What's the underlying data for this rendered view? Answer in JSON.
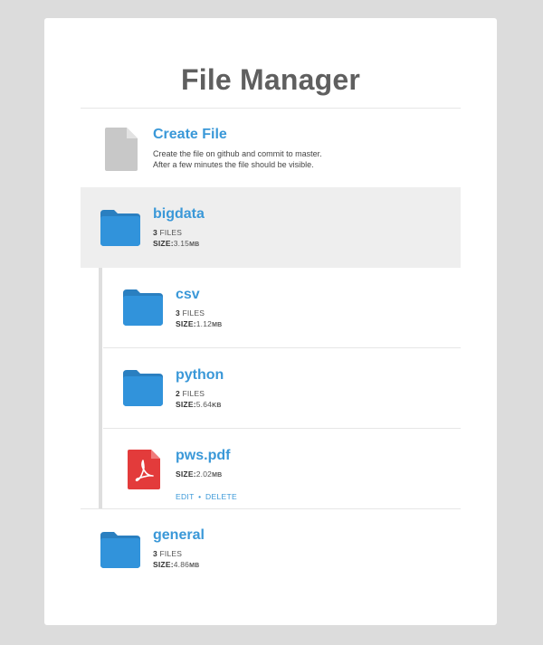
{
  "title": "File Manager",
  "create": {
    "name": "Create File",
    "description_line1": "Create the file on github and commit to master.",
    "description_line2": "After a few minutes the file should be visible."
  },
  "entries": [
    {
      "name": "bigdata",
      "count": "3",
      "files_label": "FILES",
      "size_label": "SIZE:",
      "size_value": "3.15",
      "size_unit": "MB",
      "icon": "folder-icon"
    },
    {
      "name": "csv",
      "count": "3",
      "files_label": "FILES",
      "size_label": "SIZE:",
      "size_value": "1.12",
      "size_unit": "MB",
      "icon": "folder-icon"
    },
    {
      "name": "python",
      "count": "2",
      "files_label": "FILES",
      "size_label": "SIZE:",
      "size_value": "5.64",
      "size_unit": "KB",
      "icon": "folder-icon"
    },
    {
      "name": "pws.pdf",
      "size_label": "SIZE:",
      "size_value": "2.02",
      "size_unit": "MB",
      "icon": "pdf-file-icon",
      "edit_label": "EDIT",
      "separator": "•",
      "delete_label": "DELETE"
    },
    {
      "name": "general",
      "count": "3",
      "files_label": "FILES",
      "size_label": "SIZE:",
      "size_value": "4.86",
      "size_unit": "MB",
      "icon": "folder-icon"
    }
  ],
  "colors": {
    "accent": "#3a98d8",
    "folder": "#2f8ed6",
    "pdf": "#e33b3b",
    "title": "#5f5f5f"
  }
}
